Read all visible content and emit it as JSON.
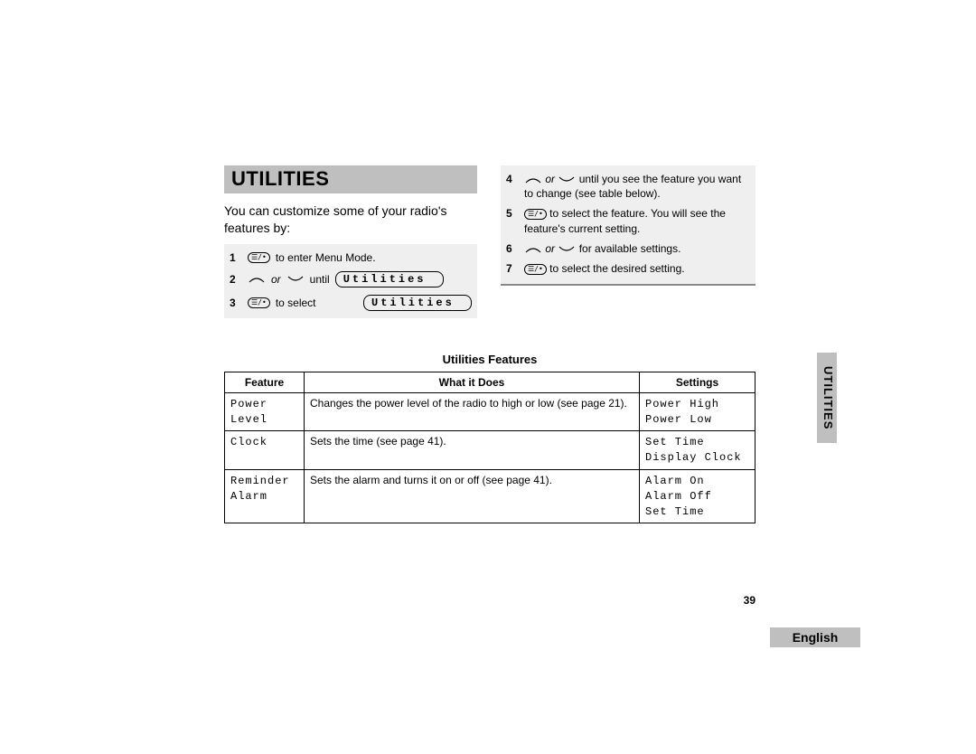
{
  "header": {
    "title": "UTILITIES"
  },
  "intro": "You can customize some of your radio's features by:",
  "left_steps": [
    {
      "num": "1",
      "key": "menu",
      "text": "to enter Menu Mode."
    },
    {
      "num": "2",
      "arrows": true,
      "text_pre": "or",
      "text_post": "until",
      "display": "Utilities"
    },
    {
      "num": "3",
      "key": "menu",
      "text": "to select",
      "display": "Utilities"
    }
  ],
  "right_steps": [
    {
      "num": "4",
      "arrows": true,
      "text": "until you see the feature you want to change (see table below)."
    },
    {
      "num": "5",
      "key": "menu",
      "text": "to select the feature. You will see the feature's current setting."
    },
    {
      "num": "6",
      "arrows": true,
      "text": "for available settings."
    },
    {
      "num": "7",
      "key": "menu",
      "text": "to select the desired setting."
    }
  ],
  "or_word": "or",
  "menu_key_glyph": "☰/•",
  "table": {
    "title": "Utilities Features",
    "headers": {
      "feature": "Feature",
      "what": "What it Does",
      "settings": "Settings"
    },
    "rows": [
      {
        "feature": "Power\nLevel",
        "what": "Changes the power level of the radio to high or low (see page 21).",
        "settings": "Power High\nPower Low"
      },
      {
        "feature": "Clock",
        "what": "Sets the time (see page 41).",
        "settings": "Set Time\nDisplay Clock"
      },
      {
        "feature": "Reminder\nAlarm",
        "what": "Sets the alarm and turns it on or off (see page 41).",
        "settings": "Alarm On\nAlarm Off\nSet Time"
      }
    ]
  },
  "page_number": "39",
  "side_tab": "UTILITIES",
  "language": "English"
}
